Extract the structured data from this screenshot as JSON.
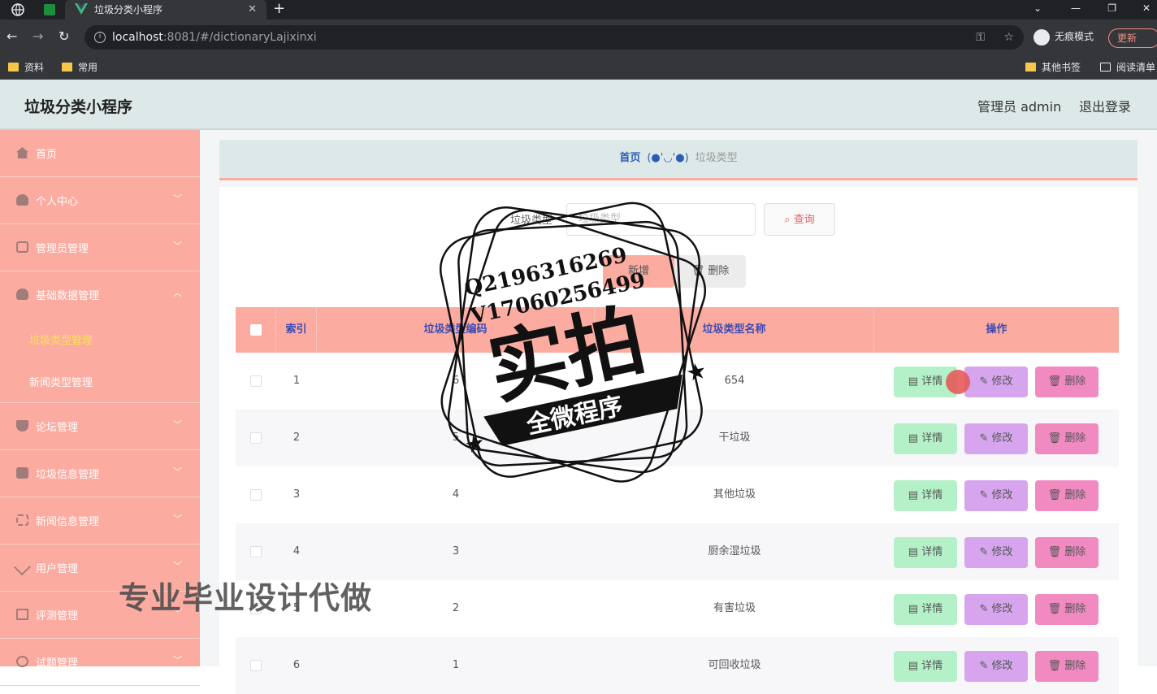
{
  "browser": {
    "tab_title": "垃圾分类小程序",
    "url_host": "localhost",
    "url_path": ":8081/#/dictionaryLajixinxi",
    "incognito_label": "无痕模式",
    "update_label": "更新",
    "bookmarks_left": [
      "资料",
      "常用"
    ],
    "bookmarks_right": [
      "其他书签",
      "阅读清单"
    ]
  },
  "header": {
    "title": "垃圾分类小程序",
    "admin_label": "管理员 admin",
    "logout_label": "退出登录"
  },
  "sidebar": {
    "items": [
      {
        "label": "首页",
        "icon": "home-icon"
      },
      {
        "label": "个人中心",
        "icon": "user-icon"
      },
      {
        "label": "管理员管理",
        "icon": "card-icon"
      },
      {
        "label": "基础数据管理",
        "icon": "user-icon"
      },
      {
        "label": "论坛管理",
        "icon": "pin-icon"
      },
      {
        "label": "垃圾信息管理",
        "icon": "clipboard-icon"
      },
      {
        "label": "新闻信息管理",
        "icon": "frame-icon"
      },
      {
        "label": "用户管理",
        "icon": "send-icon"
      },
      {
        "label": "评测管理",
        "icon": "mail-icon"
      },
      {
        "label": "试题管理",
        "icon": "clock-icon"
      }
    ],
    "subitems": [
      {
        "label": "垃圾类型管理",
        "active": true
      },
      {
        "label": "新闻类型管理",
        "active": false
      }
    ]
  },
  "breadcrumb": {
    "home": "首页",
    "separator": "(●'◡'●)",
    "current": "垃圾类型"
  },
  "search": {
    "label": "垃圾类型",
    "placeholder": "垃圾类型",
    "button": "查询"
  },
  "actions": {
    "add": "新增",
    "delete": "删除"
  },
  "table": {
    "headers": [
      "索引",
      "垃圾类型编码",
      "垃圾类型名称",
      "操作"
    ],
    "rows": [
      {
        "index": "1",
        "code": "6",
        "name": "654"
      },
      {
        "index": "2",
        "code": "5",
        "name": "干垃圾"
      },
      {
        "index": "3",
        "code": "4",
        "name": "其他垃圾"
      },
      {
        "index": "4",
        "code": "3",
        "name": "厨余湿垃圾"
      },
      {
        "index": "5",
        "code": "2",
        "name": "有害垃圾"
      },
      {
        "index": "6",
        "code": "1",
        "name": "可回收垃圾"
      }
    ],
    "row_actions": {
      "detail": "详情",
      "edit": "修改",
      "remove": "删除"
    }
  },
  "overlay": {
    "qq": "Q2196316269",
    "wechat": "V17060256499",
    "big_text": "实拍",
    "ribbon": "全微程序",
    "watermark": "专业毕业设计代做"
  },
  "colors": {
    "sidebar_bg": "#fcaba0",
    "header_bg": "#dde9e8",
    "detail_btn": "#b4f0c8",
    "edit_btn": "#d6a5ee",
    "remove_btn": "#f08ac1"
  }
}
